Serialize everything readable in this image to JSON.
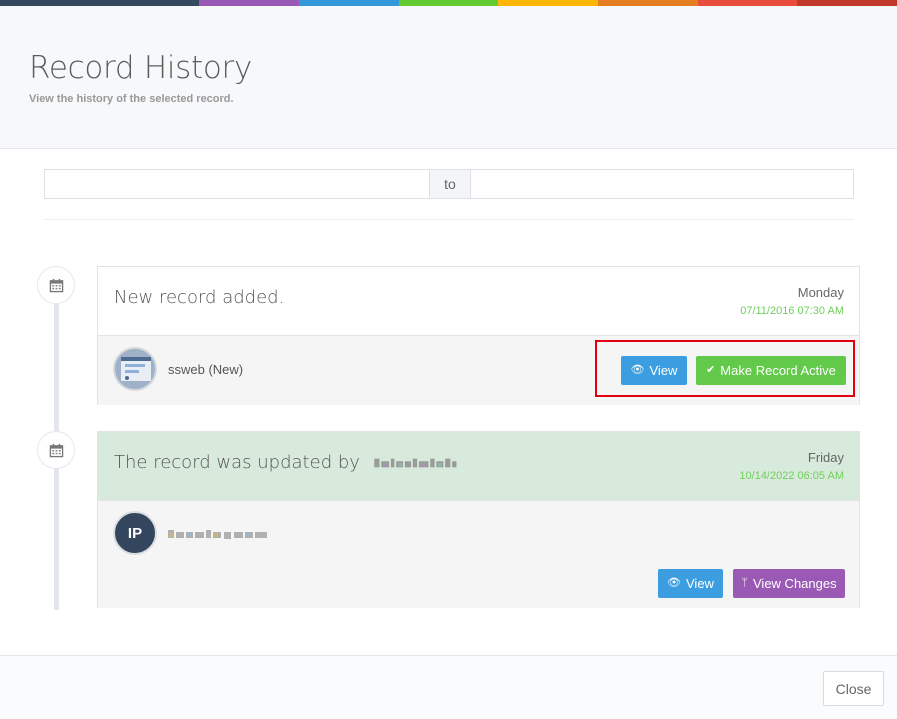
{
  "colors": {
    "top_bar": [
      "#34495e",
      "#9b59b6",
      "#3498db",
      "#62cb31",
      "#ffb606",
      "#e67e22",
      "#e74c3c",
      "#c0392b"
    ],
    "accent_blue": "#3c9ee0",
    "accent_green": "#63c94a",
    "accent_purple": "#9b59b6",
    "timestamp_green": "#6fcf5b"
  },
  "header": {
    "title": "Record History",
    "subtitle": "View the history of the selected record."
  },
  "date_filter": {
    "from_value": "",
    "to_label": "to",
    "to_value": ""
  },
  "timeline": [
    {
      "icon": "calendar-icon",
      "message": "New record added.",
      "day": "Monday",
      "timestamp": "07/11/2016 07:30 AM",
      "user": "ssweb (New)",
      "buttons": {
        "view_label": "View",
        "make_active_label": "Make Record Active"
      }
    },
    {
      "icon": "calendar-icon",
      "message": "The record was updated by",
      "day": "Friday",
      "timestamp": "10/14/2022 06:05 AM",
      "user_initials": "IP",
      "buttons": {
        "view_label": "View",
        "view_changes_label": "View Changes"
      }
    }
  ],
  "footer": {
    "close_label": "Close"
  }
}
